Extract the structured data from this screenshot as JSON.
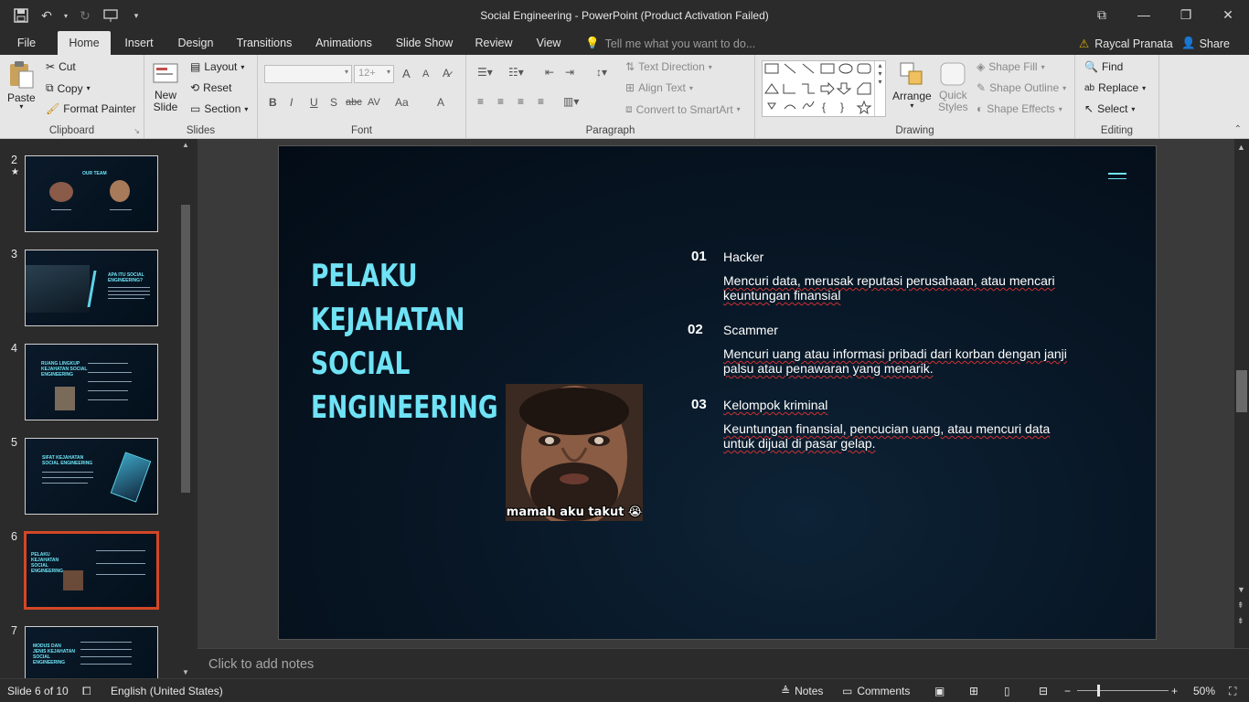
{
  "window": {
    "title": "Social Engineering - PowerPoint (Product Activation Failed)"
  },
  "tabs": [
    {
      "label": "File"
    },
    {
      "label": "Home"
    },
    {
      "label": "Insert"
    },
    {
      "label": "Design"
    },
    {
      "label": "Transitions"
    },
    {
      "label": "Animations"
    },
    {
      "label": "Slide Show"
    },
    {
      "label": "Review"
    },
    {
      "label": "View"
    }
  ],
  "tellme": {
    "placeholder": "Tell me what you want to do..."
  },
  "account": {
    "user": "Raycal Pranata",
    "share": "Share"
  },
  "ribbon": {
    "clipboard": {
      "paste": "Paste",
      "cut": "Cut",
      "copy": "Copy",
      "format_painter": "Format Painter",
      "label": "Clipboard"
    },
    "slides": {
      "new_slide_1": "New",
      "new_slide_2": "Slide",
      "layout": "Layout",
      "reset": "Reset",
      "section": "Section",
      "label": "Slides"
    },
    "font": {
      "size": "12+",
      "label": "Font",
      "bold": "B",
      "italic": "I",
      "underline": "U",
      "shadow": "S",
      "strike": "abc",
      "spacing": "AV",
      "case": "Aa",
      "grow": "A",
      "shrink": "A",
      "color": "A"
    },
    "paragraph": {
      "text_direction": "Text Direction",
      "align_text": "Align Text",
      "convert_smartart": "Convert to SmartArt",
      "label": "Paragraph"
    },
    "drawing": {
      "arrange": "Arrange",
      "quick_styles_1": "Quick",
      "quick_styles_2": "Styles",
      "shape_fill": "Shape Fill",
      "shape_outline": "Shape Outline",
      "shape_effects": "Shape Effects",
      "label": "Drawing"
    },
    "editing": {
      "find": "Find",
      "replace": "Replace",
      "select": "Select",
      "label": "Editing"
    }
  },
  "thumbnails": [
    {
      "number": "2",
      "title": "OUR TEAM",
      "star": "★"
    },
    {
      "number": "3",
      "title": "APA ITU SOCIAL ENGINEERING?"
    },
    {
      "number": "4",
      "title": "RUANG LINGKUP KEJAHATAN SOCIAL ENGINEERING"
    },
    {
      "number": "5",
      "title": "SIFAT KEJAHATAN SOCIAL ENGINEERING"
    },
    {
      "number": "6",
      "title": "PELAKU KEJAHATAN SOCIAL ENGINEERING"
    },
    {
      "number": "7",
      "title": "MODUS DAN JENIS KEJAHATAN SOCIAL ENGINEERING"
    }
  ],
  "slide": {
    "title_line1": "PELAKU KEJAHATAN",
    "title_line2": "SOCIAL ENGINEERING",
    "photo_caption": "mamah aku takut 😭",
    "items": [
      {
        "num": "01",
        "title": "Hacker",
        "desc": "Mencuri data, merusak reputasi perusahaan, atau mencari keuntungan finansial"
      },
      {
        "num": "02",
        "title": "Scammer",
        "desc": "Mencuri uang atau informasi pribadi dari korban dengan janji palsu atau penawaran yang menarik."
      },
      {
        "num": "03",
        "title": "Kelompok kriminal",
        "desc": "Keuntungan finansial, pencucian uang, atau mencuri data untuk dijual di pasar gelap."
      }
    ]
  },
  "notes": {
    "placeholder": "Click to add notes"
  },
  "status": {
    "slide_info": "Slide 6 of 10",
    "language": "English (United States)",
    "notes": "Notes",
    "comments": "Comments",
    "zoom": "50%"
  },
  "colors": {
    "accent": "#6fe3f5",
    "selection": "#d24726",
    "slide_bg": "#061522"
  }
}
